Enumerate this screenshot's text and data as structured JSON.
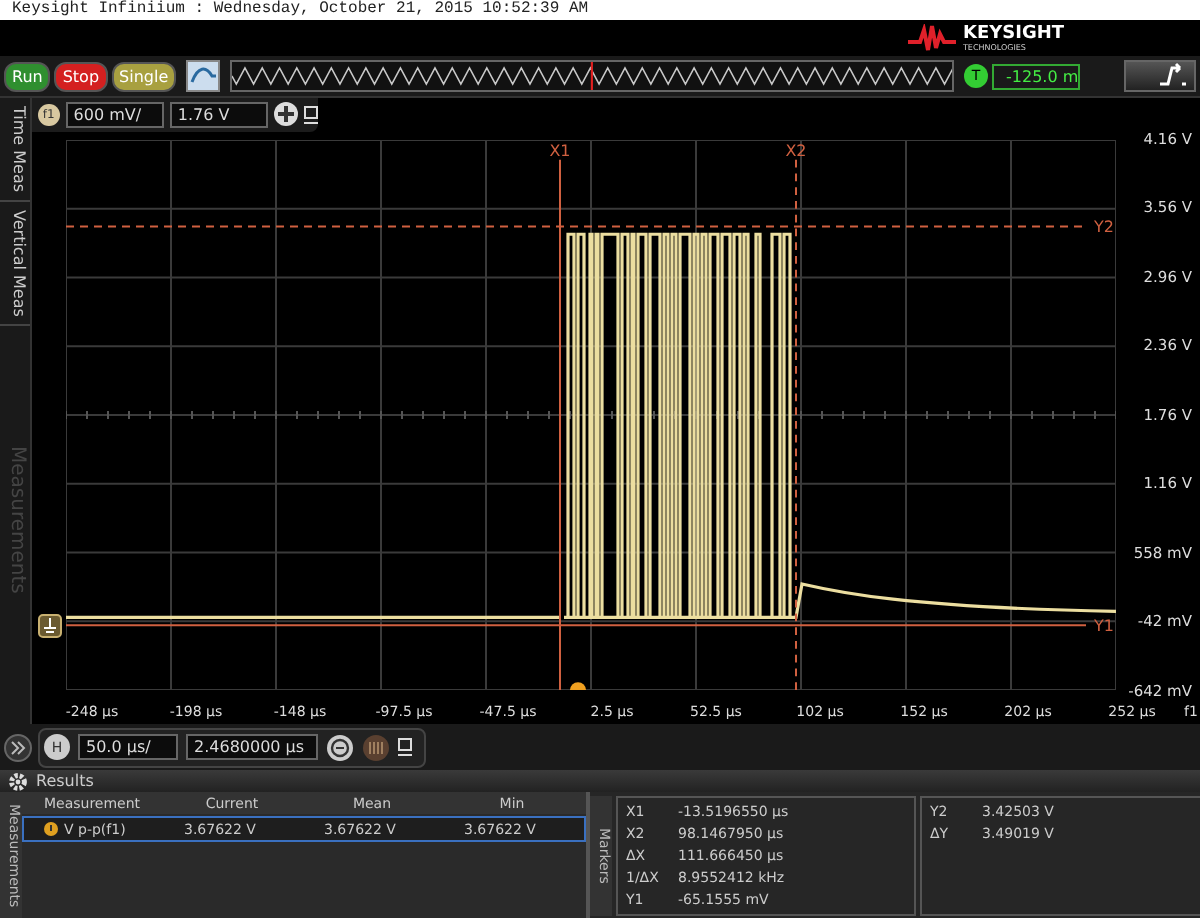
{
  "window": {
    "title": "Keysight Infiniium : Wednesday, October 21, 2015 10:52:39 AM"
  },
  "logo": {
    "brand": "KEYSIGHT",
    "tagline": "TECHNOLOGIES"
  },
  "run_controls": [
    {
      "label": "Run",
      "color": "#2f8f2f"
    },
    {
      "label": "Stop",
      "color": "#d42020"
    },
    {
      "label": "Single",
      "color": "#a8a040"
    }
  ],
  "trigger": {
    "badge": "T",
    "level": "-125.0 m"
  },
  "side_tabs": [
    {
      "label": "Time Meas",
      "disabled": false
    },
    {
      "label": "Vertical Meas",
      "disabled": false
    },
    {
      "label": "Measurements",
      "disabled": true
    }
  ],
  "channel": {
    "badge": "f1",
    "scale": "600 mV/",
    "offset": "1.76 V"
  },
  "plot": {
    "y_labels": [
      "4.16 V",
      "3.56 V",
      "2.96 V",
      "2.36 V",
      "1.76 V",
      "1.16 V",
      "558 mV",
      "-42 mV",
      "-642 mV"
    ],
    "x_labels": [
      "-248 µs",
      "-198 µs",
      "-148 µs",
      "-97.5 µs",
      "-47.5 µs",
      "2.5 µs",
      "52.5 µs",
      "102 µs",
      "152 µs",
      "202 µs",
      "252 µs"
    ],
    "x_unit_label": "f1",
    "markers": [
      {
        "label": "X1",
        "kind": "vertical"
      },
      {
        "label": "X2",
        "kind": "vertical"
      },
      {
        "label": "Y2",
        "kind": "horizontal"
      },
      {
        "label": "Y1",
        "kind": "horizontal"
      }
    ]
  },
  "horizontal": {
    "badge": "H",
    "scale": "50.0 µs/",
    "position": "2.4680000 µs"
  },
  "results": {
    "title": "Results",
    "tab": "Measurements",
    "columns": [
      "Measurement",
      "Current",
      "Mean",
      "Min"
    ],
    "rows": [
      {
        "cells": [
          "V p-p(f1)",
          "3.67622 V",
          "3.67622 V",
          "3.67622 V"
        ],
        "selected": true
      }
    ]
  },
  "markers_panel": {
    "tab": "Markers",
    "left": [
      {
        "name": "X1",
        "value": "-13.5196550 µs"
      },
      {
        "name": "X2",
        "value": "98.1467950 µs"
      },
      {
        "name": "ΔX",
        "value": "111.666450 µs"
      },
      {
        "name": "1/ΔX",
        "value": "8.9552412 kHz"
      },
      {
        "name": "Y1",
        "value": "-65.1555 mV"
      }
    ],
    "right": [
      {
        "name": "Y2",
        "value": "3.42503 V"
      },
      {
        "name": "ΔY",
        "value": "3.49019 V"
      }
    ]
  }
}
